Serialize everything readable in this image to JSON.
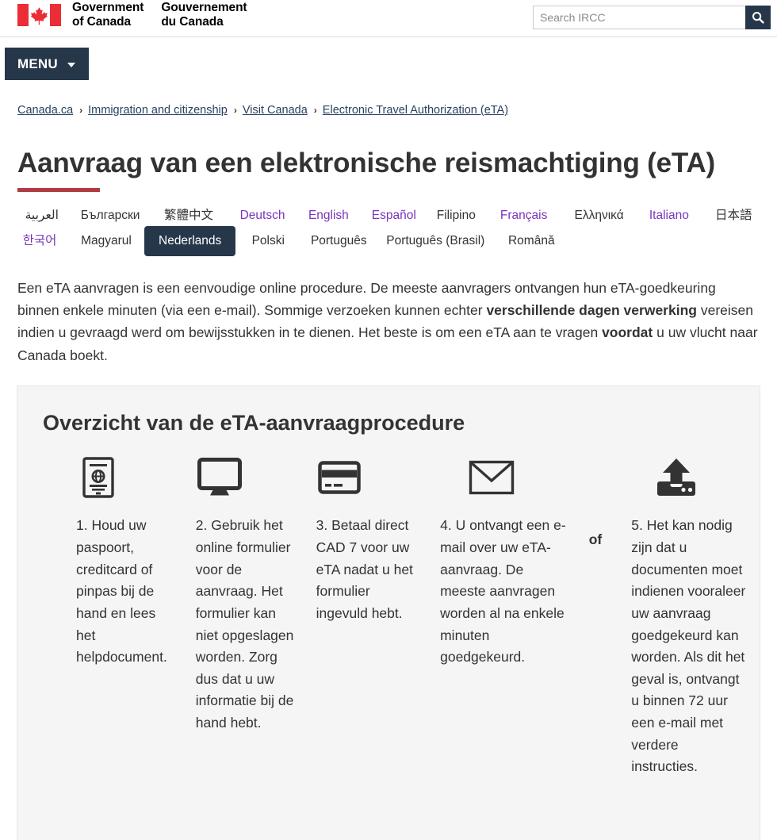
{
  "header": {
    "flag_alt": "canada-flag",
    "gov_en_line1": "Government",
    "gov_en_line2": "of Canada",
    "gov_fr_line1": "Gouvernement",
    "gov_fr_line2": "du Canada",
    "search_placeholder": "Search IRCC",
    "search_value": "",
    "search_icon": "search-icon",
    "menu_label": "MENU",
    "menu_caret_icon": "chevron-down-icon"
  },
  "breadcrumb": {
    "separator": "›",
    "items": [
      {
        "label": "Canada.ca"
      },
      {
        "label": "Immigration and citizenship"
      },
      {
        "label": "Visit Canada"
      },
      {
        "label": "Electronic Travel Authorization (eTA)"
      }
    ]
  },
  "page": {
    "title": "Aanvraag van een elektronische reismachtiging (eTA)",
    "accent_color": "#af3c43"
  },
  "languages": {
    "visited_color": "#7834bc",
    "default_color": "#333333",
    "active_bg": "#26374a",
    "row1": [
      {
        "label": "العربية",
        "state": "default"
      },
      {
        "label": "Български",
        "state": "default"
      },
      {
        "label": "繁體中文",
        "state": "default"
      },
      {
        "label": "Deutsch",
        "state": "visited"
      },
      {
        "label": "English",
        "state": "visited"
      },
      {
        "label": "Español",
        "state": "visited"
      },
      {
        "label": "Filipino",
        "state": "default"
      },
      {
        "label": "Français",
        "state": "visited"
      },
      {
        "label": "Ελληνικά",
        "state": "default"
      },
      {
        "label": "Italiano",
        "state": "visited"
      },
      {
        "label": "日本語",
        "state": "default"
      }
    ],
    "row2": [
      {
        "label": "한국어",
        "state": "visited"
      },
      {
        "label": "Magyarul",
        "state": "default"
      },
      {
        "label": "Nederlands",
        "state": "active"
      },
      {
        "label": "Polski",
        "state": "default"
      },
      {
        "label": "Português",
        "state": "default"
      },
      {
        "label": "Português (Brasil)",
        "state": "default"
      },
      {
        "label": "Română",
        "state": "default"
      }
    ]
  },
  "intro": {
    "part1": "Een eTA aanvragen is een eenvoudige online procedure. De meeste aanvragers ontvangen hun eTA-goedkeuring binnen enkele minuten (via een e-mail). Sommige verzoeken kunnen echter ",
    "bold1": "verschillende dagen verwerking",
    "part2": " vereisen indien u gevraagd werd om bewijsstukken in te dienen. Het beste is om een eTA aan te vragen ",
    "bold2": "voordat",
    "part3": " u uw vlucht naar Canada boekt."
  },
  "overview": {
    "heading": "Overzicht van de eTA-aanvraagprocedure",
    "or_label": "of",
    "steps": [
      {
        "icon": "passport-icon",
        "text": "1. Houd uw paspoort, creditcard of pinpas bij de hand en lees het helpdocument."
      },
      {
        "icon": "desktop-monitor-icon",
        "text": "2. Gebruik het online formulier voor de aanvraag. Het formulier kan niet opgeslagen worden. Zorg dus dat u uw informatie bij de hand hebt."
      },
      {
        "icon": "credit-card-icon",
        "text": "3. Betaal direct CAD 7 voor uw eTA nadat u het formulier ingevuld hebt."
      },
      {
        "icon": "envelope-icon",
        "text": "4. U ontvangt een e-mail over uw eTA-aanvraag. De meeste aanvragen worden al na enkele minuten goedgekeurd."
      },
      {
        "icon": "upload-icon",
        "text": "5. Het kan nodig zijn dat u documenten moet indienen vooraleer uw aanvraag goedgekeurd kan worden. Als dit het geval is, ontvangt u binnen 72 uur een e-mail met verdere instructies."
      }
    ]
  }
}
